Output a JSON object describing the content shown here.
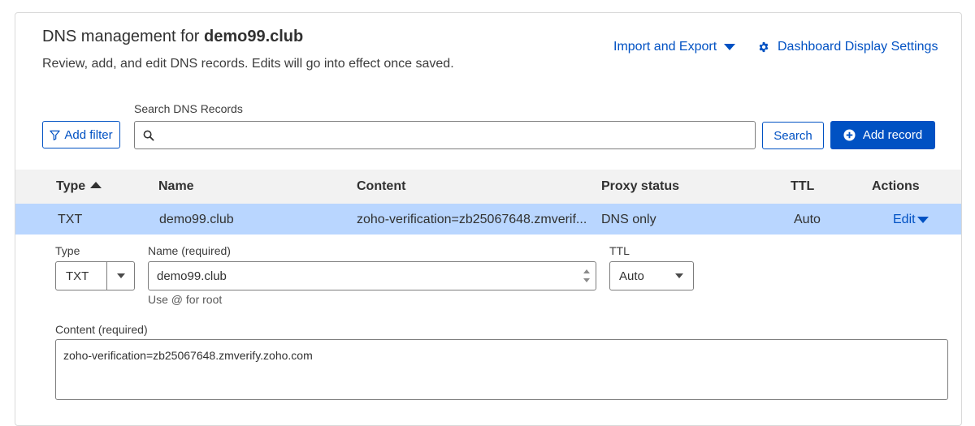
{
  "header": {
    "title_prefix": "DNS management for ",
    "domain": "demo99.club",
    "subtitle": "Review, add, and edit DNS records. Edits will go into effect once saved.",
    "import_export": "Import and Export",
    "dashboard_settings": "Dashboard Display Settings"
  },
  "search": {
    "label": "Search DNS Records",
    "value": "",
    "placeholder": "",
    "add_filter": "Add filter",
    "search_button": "Search",
    "add_record": "Add record"
  },
  "table": {
    "columns": [
      "Type",
      "Name",
      "Content",
      "Proxy status",
      "TTL",
      "Actions"
    ],
    "sort_column": "Type",
    "rows": [
      {
        "type": "TXT",
        "name": "demo99.club",
        "content": "zoho-verification=zb25067648.zmverif...",
        "proxy_status": "DNS only",
        "ttl": "Auto",
        "action": "Edit"
      }
    ]
  },
  "edit_form": {
    "type_label": "Type",
    "type_value": "TXT",
    "name_label": "Name (required)",
    "name_value": "demo99.club",
    "name_hint": "Use @ for root",
    "ttl_label": "TTL",
    "ttl_value": "Auto",
    "content_label": "Content (required)",
    "content_value": "zoho-verification=zb25067648.zmverify.zoho.com"
  },
  "colors": {
    "accent": "#0051c3",
    "selected_row": "#b9d6ff",
    "header_bg": "#f2f2f2"
  }
}
